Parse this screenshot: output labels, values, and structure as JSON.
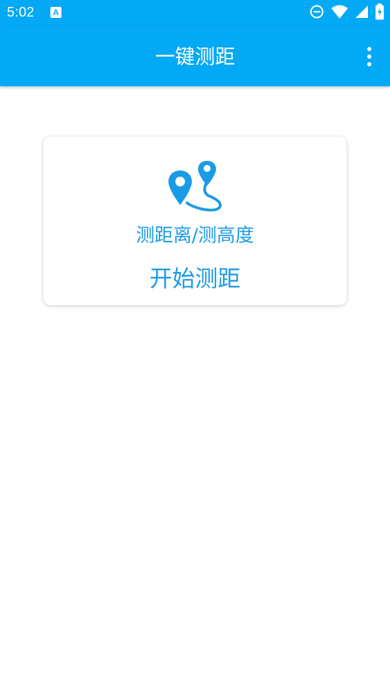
{
  "status_bar": {
    "time": "5:02",
    "notification_icon": "A",
    "icons": [
      "do-not-disturb-icon",
      "wifi-icon",
      "cell-signal-icon",
      "battery-charging-icon"
    ],
    "background": "#03a9f4"
  },
  "app_bar": {
    "title": "一键测距",
    "menu_icon": "more-vertical-icon",
    "background": "#03a9f4"
  },
  "card": {
    "icon": "route-pins-icon",
    "subtitle": "测距离/测高度",
    "action_label": "开始测距",
    "accent_color": "#1a9be6"
  }
}
